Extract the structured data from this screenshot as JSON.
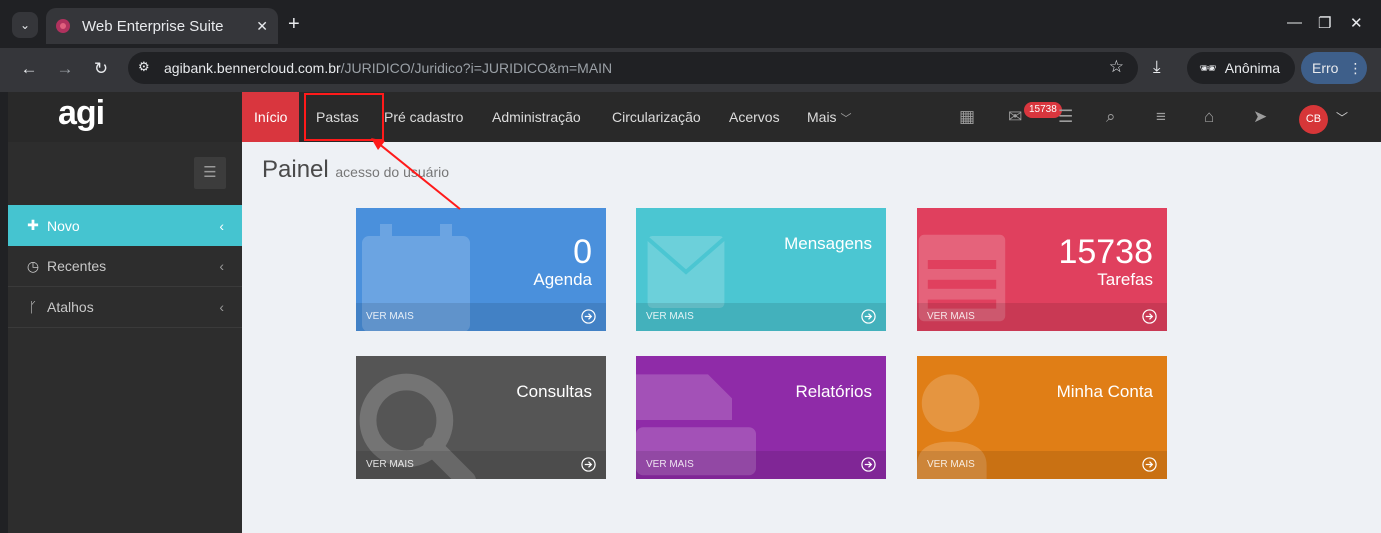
{
  "browser": {
    "tab_title": "Web Enterprise Suite",
    "url_host": "agibank.bennercloud.com.br",
    "url_path": "/JURIDICO/Juridico?i=JURIDICO&m=MAIN",
    "incognito_label": "Anônima",
    "error_label": "Erro",
    "icons": [
      "tab-list-icon",
      "close-icon",
      "plus-icon",
      "minimize-icon",
      "restore-icon",
      "back-icon",
      "forward-icon",
      "reload-icon",
      "site-info-icon",
      "star-icon",
      "download-icon",
      "incognito-icon",
      "kebab-icon"
    ]
  },
  "app": {
    "logo": "agi",
    "menu": [
      {
        "label": "Início",
        "active": true
      },
      {
        "label": "Pastas"
      },
      {
        "label": "Pré cadastro"
      },
      {
        "label": "Administração"
      },
      {
        "label": "Circularização"
      },
      {
        "label": "Acervos"
      },
      {
        "label": "Mais"
      }
    ],
    "icons": [
      "calendar-icon",
      "mail-icon",
      "inbox-icon",
      "search-icon",
      "list-icon",
      "factory-icon",
      "send-icon",
      "chevron-down-icon"
    ],
    "notification_count": "15738",
    "avatar_initials": "CB",
    "accent_color": "#d9363e"
  },
  "sidebar": {
    "items": [
      {
        "label": "Novo",
        "icon": "plus-icon",
        "active": true
      },
      {
        "label": "Recentes",
        "icon": "clock-icon"
      },
      {
        "label": "Atalhos",
        "icon": "branch-icon"
      }
    ]
  },
  "page": {
    "title": "Painel",
    "subtitle": "acesso do usuário"
  },
  "tiles": [
    {
      "label": "Agenda",
      "value": "0",
      "more": "VER MAIS",
      "color": "#4a90dc",
      "icon": "calendar-icon"
    },
    {
      "label": "Mensagens",
      "value": "",
      "more": "VER MAIS",
      "color": "#4bc6d2",
      "icon": "envelope-icon"
    },
    {
      "label": "Tarefas",
      "value": "15738",
      "more": "VER MAIS",
      "color": "#e0405e",
      "icon": "tasks-icon"
    },
    {
      "label": "Consultas",
      "value": "",
      "more": "VER MAIS",
      "color": "#555555",
      "icon": "search-icon"
    },
    {
      "label": "Relatórios",
      "value": "",
      "more": "VER MAIS",
      "color": "#8f2ba8",
      "icon": "printer-icon"
    },
    {
      "label": "Minha Conta",
      "value": "",
      "more": "VER MAIS",
      "color": "#e07e16",
      "icon": "user-icon"
    }
  ]
}
